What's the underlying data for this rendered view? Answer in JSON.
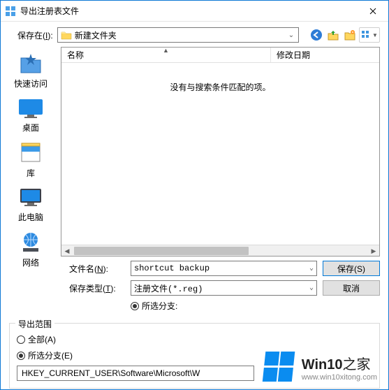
{
  "window": {
    "title": "导出注册表文件",
    "close_label": "✕"
  },
  "savein": {
    "label_prefix": "保存在(",
    "label_hotkey": "I",
    "label_suffix": "):",
    "path": "新建文件夹",
    "nav": {
      "back": "back-icon",
      "up": "up-icon",
      "newfolder": "new-folder-icon",
      "view": "view-icon"
    }
  },
  "places": [
    {
      "label": "快速访问"
    },
    {
      "label": "桌面"
    },
    {
      "label": "库"
    },
    {
      "label": "此电脑"
    },
    {
      "label": "网络"
    }
  ],
  "list": {
    "columns": {
      "name": "名称",
      "date": "修改日期"
    },
    "empty_message": "没有与搜索条件匹配的项。"
  },
  "form": {
    "filename_label_prefix": "文件名(",
    "filename_hotkey": "N",
    "filename_label_suffix": "):",
    "filename_value": "shortcut backup",
    "filetype_label_prefix": "保存类型(",
    "filetype_hotkey": "T",
    "filetype_label_suffix": "):",
    "filetype_value": "注册文件(*.reg)",
    "save_label": "保存(S)",
    "cancel_label": "取消",
    "encoding_option": "所选分支:"
  },
  "scope": {
    "legend": "导出范围",
    "all_label": "全部(A)",
    "selected_label": "所选分支(E)",
    "path_value": "HKEY_CURRENT_USER\\Software\\Microsoft\\W"
  },
  "watermark": {
    "brand": "Win10",
    "suffix": "之家",
    "url": "www.win10xitong.com"
  }
}
